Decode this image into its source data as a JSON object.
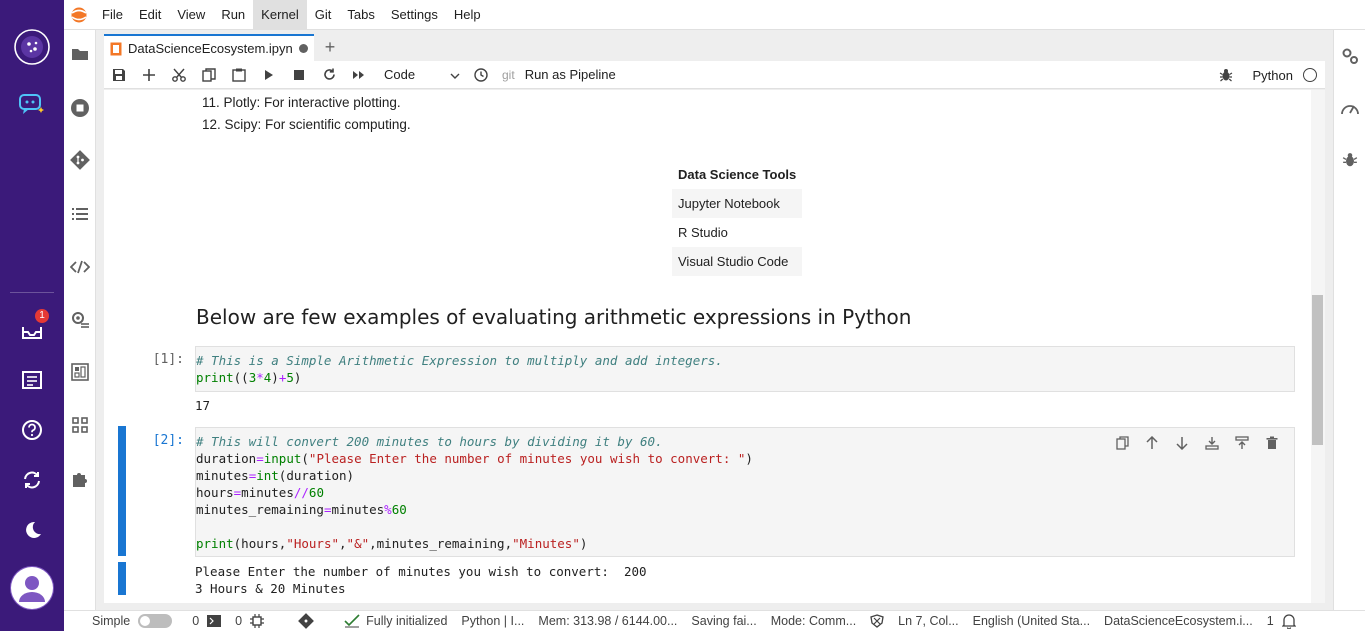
{
  "menubar": {
    "items": [
      "File",
      "Edit",
      "View",
      "Run",
      "Kernel",
      "Git",
      "Tabs",
      "Settings",
      "Help"
    ],
    "active_index": 4
  },
  "rail": {
    "notification_count": "1"
  },
  "tab": {
    "title": "DataScienceEcosystem.ipyn",
    "new_tab_symbol": "+"
  },
  "toolbar": {
    "cell_type": "Code",
    "git_label": "git",
    "pipeline_label": "Run as Pipeline",
    "kernel_name": "Python"
  },
  "notebook": {
    "list_items": [
      "11. Plotly: For interactive plotting.",
      "12. Scipy: For scientific computing."
    ],
    "table": {
      "header": "Data Science Tools",
      "rows": [
        "Jupyter Notebook",
        "R Studio",
        "Visual Studio Code"
      ]
    },
    "heading": "Below are few examples of evaluating arithmetic expressions in Python",
    "cell1": {
      "prompt": "[1]:",
      "comment": "# This is a Simple Arithmetic Expression to multiply and add integers.",
      "output": "17"
    },
    "cell2": {
      "prompt": "[2]:",
      "comment": "# This will convert 200 minutes to hours by dividing it by 60.",
      "input_str": "\"Please Enter the number of minutes you wish to convert: \"",
      "output_line1": "Please Enter the number of minutes you wish to convert:  200",
      "output_line2": "3 Hours & 20 Minutes"
    }
  },
  "statusbar": {
    "mode_label": "Simple",
    "terminals": "0",
    "kernels": "0",
    "kernel_status": "Fully initialized",
    "kernel_info": "Python | I...",
    "memory": "Mem: 313.98 / 6144.00...",
    "save_status": "Saving fai...",
    "mode": "Mode: Comm...",
    "cursor": "Ln 7, Col...",
    "language": "English (United Sta...",
    "filename": "DataScienceEcosystem.i...",
    "notifications": "1"
  },
  "colors": {
    "rail": "#3b1a7a",
    "accent": "#1976d2",
    "badge": "#e53935"
  }
}
